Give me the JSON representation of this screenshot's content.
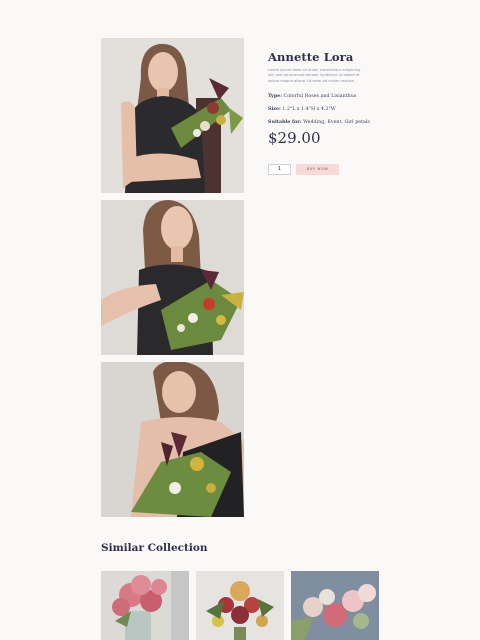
{
  "product": {
    "title": "Annette Lora",
    "description": "Lorem ipsum dolor sit amet, consectetur adipiscing elit, sed do eiusmod tempor incididunt ut labore et dolore magna aliqua. Ut enim ad minim veniam",
    "specs": [
      {
        "label": "Type:",
        "value": "Colorful Roses and Lisianthus"
      },
      {
        "label": "Size:",
        "value": "1.2\"L x 1.4\"H x 4.2\"W"
      },
      {
        "label": "Suitable for:",
        "value": "Wedding, Event, Girl petals"
      }
    ],
    "price": "$29.00",
    "quantity": "1",
    "buy_label": "BUY NOW"
  },
  "gallery": {
    "images": [
      "model-holding-bouquet-smiling",
      "model-holding-bouquet-side",
      "model-looking-down-bouquet"
    ]
  },
  "similar": {
    "title": "Similar Collection",
    "items": [
      "pink-carnation-bouquet",
      "mixed-rose-bouquet",
      "pastel-rose-bouquet"
    ]
  },
  "colors": {
    "background": "#faf9f7",
    "heading": "#2d2f4e",
    "button": "#f7d9d6"
  }
}
